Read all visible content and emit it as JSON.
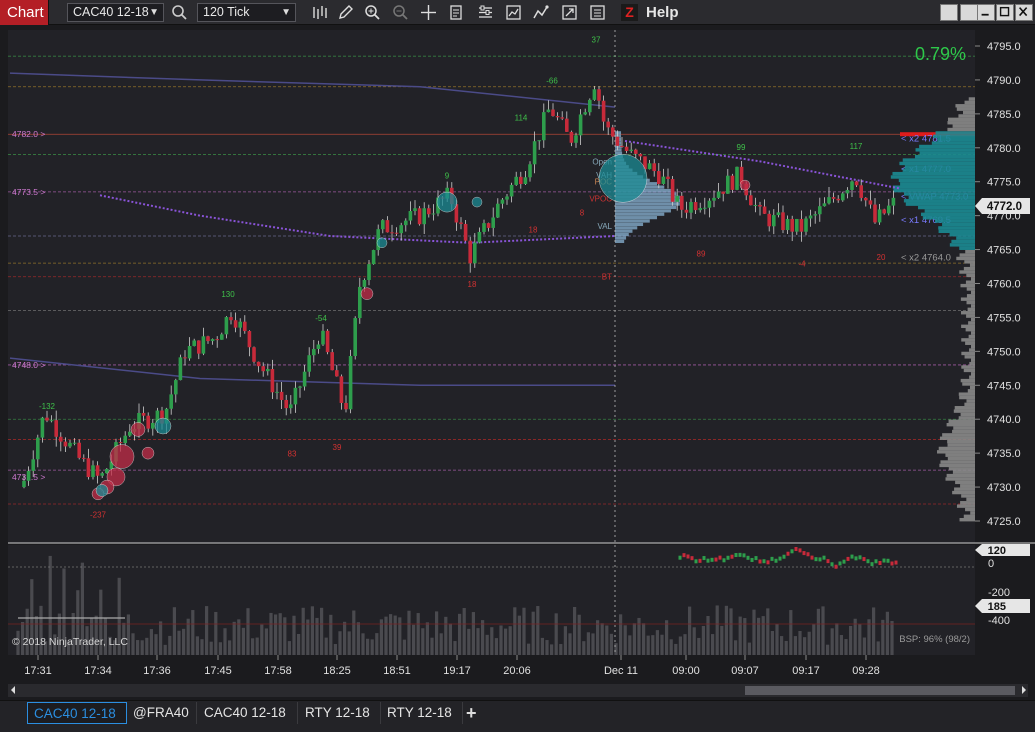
{
  "toolbar": {
    "chart_label": "Chart",
    "instrument": "CAC40 12-18",
    "period": "120 Tick",
    "help_label": "Help",
    "logo_letter": "Z",
    "icons": [
      "search-icon",
      "bar-style-icon",
      "pencil-icon",
      "zoom-in-icon",
      "zoom-out-icon",
      "crosshair-icon",
      "data-box-icon",
      "properties-icon",
      "strategies-icon",
      "indicators-icon",
      "share-icon",
      "templates-icon"
    ]
  },
  "chart": {
    "percent_change": "0.79%",
    "copyright": "© 2018 NinjaTrader, LLC",
    "bsp_label": "BSP: 96% (98/2)",
    "last_price": "4772.0",
    "price_levels": [
      "4795.0",
      "4790.0",
      "4785.0",
      "4780.0",
      "4775.0",
      "4770.0",
      "4765.0",
      "4760.0",
      "4755.0",
      "4750.0",
      "4745.0",
      "4740.0",
      "4735.0",
      "4730.0",
      "4725.0"
    ],
    "left_level_labels": [
      "4782.0",
      "4773.5",
      "4748.0",
      "4731.5"
    ],
    "profile_labels": [
      "Open",
      "VAH",
      "POC",
      "VPOC",
      "VAL",
      "BT"
    ],
    "right_annotations": [
      "x2 4781.5",
      "x1 4777.0",
      "VWAP 4773.0",
      "x1 4769.5",
      "x2 4764.0"
    ],
    "swing_labels_green": [
      "37",
      "-66",
      "114",
      "9",
      "130",
      "-54",
      "-132",
      "99",
      "117"
    ],
    "swing_labels_red": [
      "18",
      "18",
      "83",
      "39",
      "-237",
      "89",
      "-4",
      "20",
      "8"
    ],
    "indicator_value": "120",
    "indicator_value2": "185",
    "indicator_levels": [
      "0",
      "-200",
      "-400"
    ],
    "time_labels": [
      "17:31",
      "17:34",
      "17:36",
      "17:45",
      "17:58",
      "18:25",
      "18:51",
      "19:17",
      "20:06",
      "Dec 11",
      "09:00",
      "09:07",
      "09:17",
      "09:28"
    ]
  },
  "tabs": [
    "CAC40 12-18",
    "@FRA40",
    "CAC40 12-18",
    "RTY 12-18",
    "RTY 12-18"
  ],
  "add_tab_label": "+",
  "colors": {
    "up_candle": "#2e9e4c",
    "down_candle": "#c72a3a",
    "background": "#1b1b1e",
    "accent_red": "#b41f26",
    "profile_teal": "#1b8b94",
    "percent_green": "#2ec84a"
  }
}
